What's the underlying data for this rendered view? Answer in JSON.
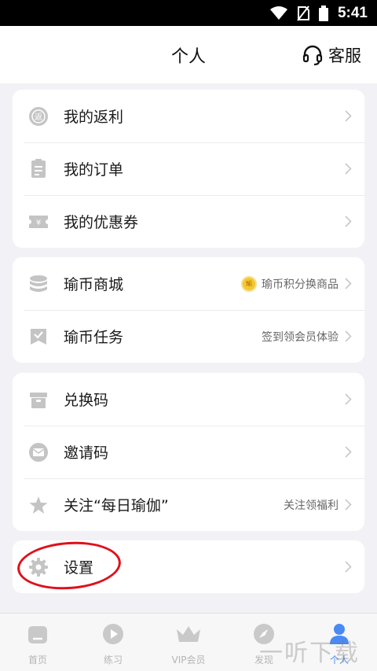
{
  "status_bar": {
    "time": "5:41"
  },
  "header": {
    "title": "个人",
    "service_label": "客服"
  },
  "group1": {
    "items": [
      {
        "label": "我的返利",
        "icon": "rebate-icon"
      },
      {
        "label": "我的订单",
        "icon": "order-icon"
      },
      {
        "label": "我的优惠券",
        "icon": "coupon-icon"
      }
    ]
  },
  "group2": {
    "items": [
      {
        "label": "瑜币商城",
        "hint": "瑜币积分换商品",
        "icon": "coin-stack-icon"
      },
      {
        "label": "瑜币任务",
        "hint": "签到领会员体验",
        "icon": "task-check-icon"
      }
    ]
  },
  "group3": {
    "items": [
      {
        "label": "兑换码",
        "icon": "redeem-box-icon"
      },
      {
        "label": "邀请码",
        "icon": "invite-envelope-icon"
      },
      {
        "label": "关注“每日瑜伽”",
        "hint": "关注领福利",
        "icon": "star-icon"
      }
    ]
  },
  "group4": {
    "items": [
      {
        "label": "设置",
        "icon": "gear-icon"
      }
    ]
  },
  "bottom_nav": {
    "items": [
      {
        "label": "首页",
        "icon": "home-icon",
        "active": false
      },
      {
        "label": "练习",
        "icon": "play-icon",
        "active": false
      },
      {
        "label": "VIP会员",
        "icon": "crown-icon",
        "active": false
      },
      {
        "label": "发现",
        "icon": "compass-icon",
        "active": false
      },
      {
        "label": "个人",
        "icon": "person-icon",
        "active": true
      }
    ]
  },
  "watermark": "一听下载",
  "colors": {
    "accent": "#4a8af4",
    "annotation": "#e0101a",
    "icon_gray": "#c4c4c4"
  }
}
